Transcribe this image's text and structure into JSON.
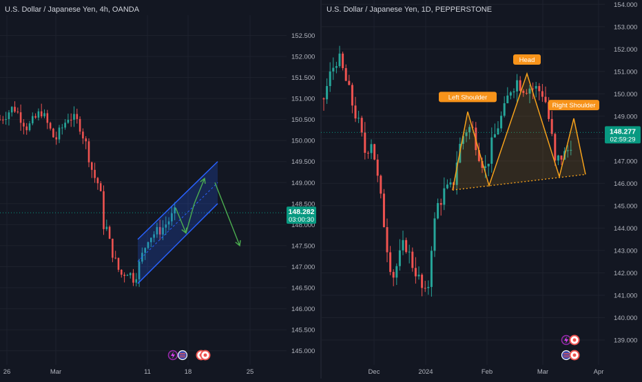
{
  "colors": {
    "bg": "#131722",
    "grid": "#1e222d",
    "axis_text": "#b2b5be",
    "divider": "#2a2e39",
    "up": "#26a69a",
    "down": "#ef5350",
    "channel": "#2962ff",
    "arrow": "#4caf50",
    "pattern": "#f7a21b",
    "label_bg": "#f7931a",
    "price_tag": "#089981"
  },
  "chart_data": [
    {
      "type": "candlestick",
      "title": "U.S. Dollar / Japanese Yen, 4h, OANDA",
      "y_ticks": [
        "152.500",
        "152.000",
        "151.500",
        "151.000",
        "150.500",
        "150.000",
        "149.500",
        "149.000",
        "148.500",
        "148.000",
        "147.500",
        "147.000",
        "146.500",
        "146.000",
        "145.500",
        "145.000"
      ],
      "ylim": [
        144.7,
        152.9
      ],
      "x_ticks": [
        "26",
        "Mar",
        "11",
        "18",
        "25"
      ],
      "last_price": "148.282",
      "countdown": "03:00:30",
      "path_points": [
        [
          0,
          150.5
        ],
        [
          20,
          150.8
        ],
        [
          40,
          150.3
        ],
        [
          60,
          150.7
        ],
        [
          80,
          150.0
        ],
        [
          100,
          150.6
        ],
        [
          115,
          150.4
        ],
        [
          125,
          149.9
        ],
        [
          135,
          149.2
        ],
        [
          145,
          148.9
        ],
        [
          150,
          148.0
        ],
        [
          155,
          147.9
        ],
        [
          160,
          147.5
        ],
        [
          168,
          147.1
        ],
        [
          175,
          146.8
        ],
        [
          185,
          146.9
        ],
        [
          195,
          146.7
        ],
        [
          205,
          147.2
        ],
        [
          215,
          147.7
        ],
        [
          225,
          147.8
        ],
        [
          235,
          147.9
        ],
        [
          245,
          148.1
        ],
        [
          255,
          148.3
        ]
      ],
      "channel": {
        "lower": [
          [
            200,
            146.6
          ],
          [
            316,
            148.5
          ]
        ],
        "upper": [
          [
            200,
            147.65
          ],
          [
            316,
            149.5
          ]
        ]
      },
      "arrows": [
        [
          [
            255,
            148.4
          ],
          [
            270,
            147.8
          ],
          [
            282,
            148.5
          ],
          [
            297,
            149.1
          ],
          [
            312,
            149.0
          ],
          [
            348,
            147.5
          ]
        ]
      ]
    },
    {
      "type": "candlestick",
      "title": "U.S. Dollar / Japanese Yen, 1D, PEPPERSTONE",
      "y_ticks": [
        "154.000",
        "153.000",
        "152.000",
        "151.000",
        "150.000",
        "149.000",
        "148.000",
        "147.000",
        "146.000",
        "145.000",
        "144.000",
        "143.000",
        "142.000",
        "141.000",
        "140.000",
        "139.000"
      ],
      "ylim": [
        138.6,
        154.1
      ],
      "x_ticks": [
        "Dec",
        "2024",
        "Feb",
        "Mar",
        "Apr"
      ],
      "last_price": "148.277",
      "countdown": "02:59:29",
      "path_points": [
        [
          470,
          149.8
        ],
        [
          480,
          150.9
        ],
        [
          490,
          151.7
        ],
        [
          500,
          150.8
        ],
        [
          510,
          149.7
        ],
        [
          520,
          148.7
        ],
        [
          530,
          147.4
        ],
        [
          540,
          148.0
        ],
        [
          548,
          146.2
        ],
        [
          555,
          144.8
        ],
        [
          562,
          143.2
        ],
        [
          570,
          141.8
        ],
        [
          578,
          142.5
        ],
        [
          588,
          143.4
        ],
        [
          597,
          142.5
        ],
        [
          605,
          142.0
        ],
        [
          612,
          141.3
        ],
        [
          620,
          140.8
        ],
        [
          627,
          143.5
        ],
        [
          635,
          145.0
        ],
        [
          645,
          145.6
        ],
        [
          657,
          145.8
        ],
        [
          665,
          147.4
        ],
        [
          675,
          148.4
        ],
        [
          685,
          148.5
        ],
        [
          695,
          147.4
        ],
        [
          705,
          146.6
        ],
        [
          713,
          147.6
        ],
        [
          723,
          148.6
        ],
        [
          733,
          149.3
        ],
        [
          740,
          150.2
        ],
        [
          750,
          150.6
        ],
        [
          760,
          150.3
        ],
        [
          770,
          150.3
        ],
        [
          780,
          150.2
        ],
        [
          790,
          150.0
        ],
        [
          800,
          148.3
        ],
        [
          806,
          146.8
        ],
        [
          813,
          147.2
        ],
        [
          822,
          147.3
        ],
        [
          833,
          148.2
        ]
      ],
      "pattern": {
        "points": [
          [
            657,
            145.7
          ],
          [
            679,
            149.2
          ],
          [
            710,
            145.9
          ],
          [
            765,
            150.9
          ],
          [
            812,
            146.3
          ],
          [
            833,
            148.9
          ],
          [
            850,
            146.4
          ]
        ],
        "neckline": [
          [
            657,
            145.7
          ],
          [
            850,
            146.4
          ]
        ]
      },
      "annotations": [
        "Left Shoulder",
        "Head",
        "Right Shoulder"
      ]
    }
  ]
}
